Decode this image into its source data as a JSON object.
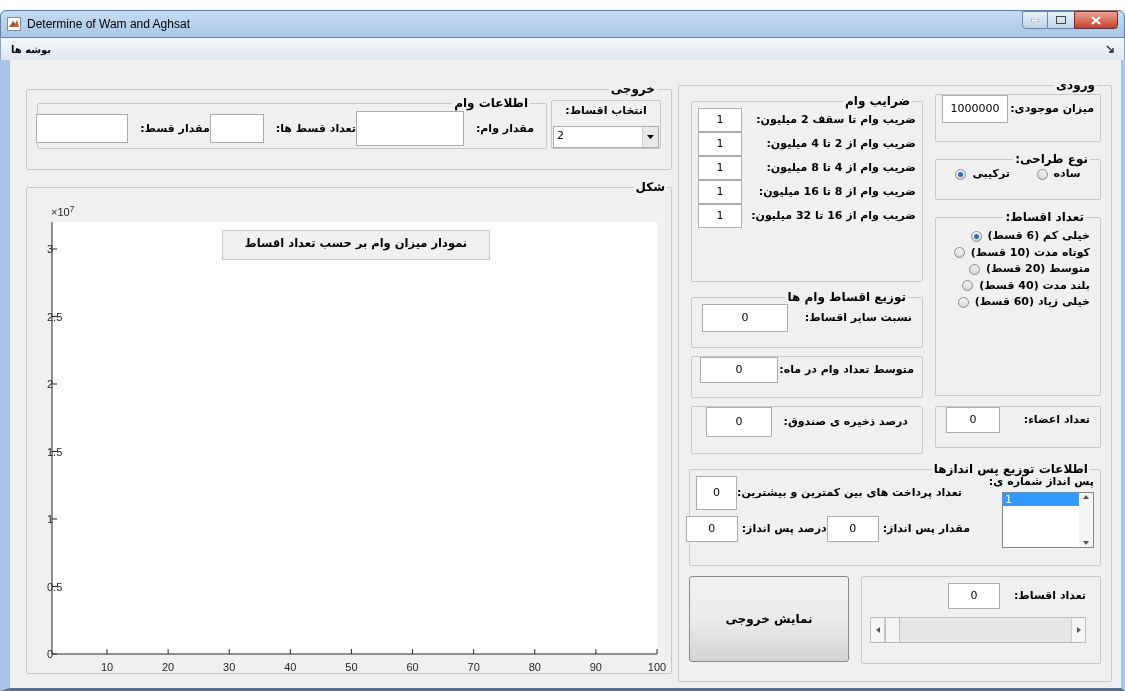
{
  "window": {
    "title": "Determine of Wam and Aghsat"
  },
  "menu": [
    {
      "label": "بوشه ها"
    }
  ],
  "output_panel": {
    "title": "خروجی",
    "installment_select": {
      "title": "انتخاب اقساط:",
      "value": "2"
    },
    "loan_info": {
      "title": "اطلاعات  وام",
      "fields": [
        {
          "label": "مقدار وام:"
        },
        {
          "label": "تعداد قسط ها:"
        },
        {
          "label": "مقدار قسط:"
        }
      ]
    }
  },
  "figure_panel": {
    "title": "شکل",
    "plot_title": "نمودار میزان وام بر حسب تعداد اقساط",
    "multiplier": "×10$^{7}$",
    "chart_data": {
      "type": "line",
      "xlim": [
        1,
        100
      ],
      "ylim": [
        0,
        3.2
      ],
      "xticks": [
        10,
        20,
        30,
        40,
        50,
        60,
        70,
        80,
        90,
        100
      ],
      "yticks": [
        0,
        0.5,
        1,
        1.5,
        2,
        2.5,
        3
      ]
    }
  },
  "input_panel": {
    "title": "ورودی",
    "stock": {
      "label": "میزان موجودی:",
      "value": "1000000"
    },
    "design_type": {
      "title": "نوع طراحی:",
      "options": [
        {
          "label": "ساده",
          "selected": false
        },
        {
          "label": "ترکیبی",
          "selected": true
        }
      ]
    },
    "installments": {
      "title": "تعداد اقساط:",
      "options": [
        {
          "label": "خیلی کم (6 قسط)",
          "selected": true
        },
        {
          "label": "کوتاه مدت (10 قسط)",
          "selected": false
        },
        {
          "label": "متوسط (20 قسط)",
          "selected": false
        },
        {
          "label": "بلند مدت (40 قسط)",
          "selected": false
        },
        {
          "label": "خیلی زیاد (60 قسط)",
          "selected": false
        }
      ]
    },
    "members": {
      "label": "تعداد اعضاء:",
      "value": "0"
    },
    "loan_coefficients": {
      "title": "ضرایب وام",
      "rows": [
        {
          "label": "ضریب وام تا سقف 2 میلیون:",
          "value": "1"
        },
        {
          "label": "ضریب وام از 2 تا 4 میلیون:",
          "value": "1"
        },
        {
          "label": "ضریب وام از 4 تا 8 میلیون:",
          "value": "1"
        },
        {
          "label": "ضریب وام از 8 تا 16 میلیون:",
          "value": "1"
        },
        {
          "label": "ضریب وام از 16 تا 32 میلیون:",
          "value": "1"
        }
      ]
    },
    "distribution": {
      "title": "توزیع اقساط وام ها",
      "label": "نسبت سایر اقساط:",
      "value": "0"
    },
    "avg_loans": {
      "label": "متوسط تعداد وام در ماه:",
      "value": "0"
    },
    "reserve": {
      "label": "درصد ذخیره ی صندوق:",
      "value": "0"
    },
    "savings": {
      "title": "اطلاعات توزیع پس اندازها",
      "list_label": "پس انداز شماره ی:",
      "list_items": [
        {
          "label": "1",
          "selected": true
        }
      ],
      "payments": {
        "label": "تعداد پرداخت های بین کمترین و بیشترین:",
        "value": "0"
      },
      "amount": {
        "label": "مقدار پس انداز:",
        "value": "0"
      },
      "percent": {
        "label": "درصد پس انداز:",
        "value": "0"
      }
    },
    "slider_panel": {
      "label": "تعداد اقساط:",
      "value": "0",
      "level": 0
    },
    "show_button": "نمایش خروجی"
  }
}
